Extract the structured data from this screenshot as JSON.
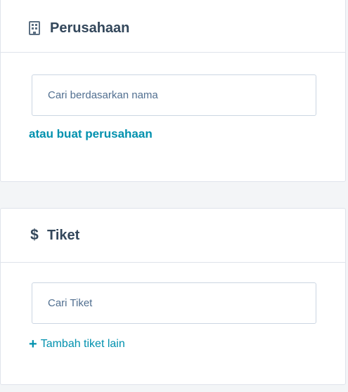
{
  "company": {
    "title": "Perusahaan",
    "icon": "building-icon",
    "search_placeholder": "Cari berdasarkan nama",
    "create_link": "atau buat perusahaan"
  },
  "ticket": {
    "title": "Tiket",
    "icon": "dollar-icon",
    "search_placeholder": "Cari Tiket",
    "add_link": "Tambah tiket lain"
  },
  "colors": {
    "link": "#0091ae",
    "border": "#dfe3eb",
    "text": "#33475b"
  }
}
